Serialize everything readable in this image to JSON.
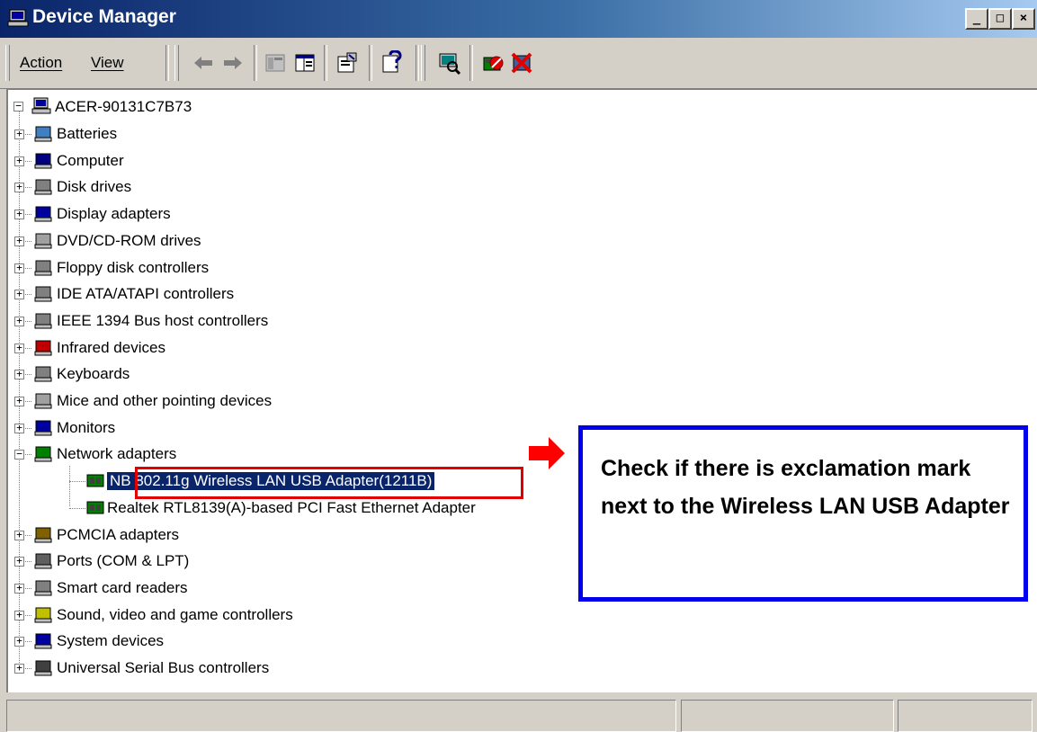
{
  "window": {
    "title": "Device Manager",
    "controls": {
      "minimize": "_",
      "maximize": "□",
      "close": "×"
    }
  },
  "menu": {
    "action_label": "Action",
    "view_label": "View"
  },
  "toolbar_icons": [
    "back-arrow-icon",
    "forward-arrow-icon",
    "show-hide-console-tree-icon",
    "detail-view-icon",
    "properties-icon",
    "help-icon",
    "scan-hardware-icon",
    "uninstall-icon",
    "disable-device-icon"
  ],
  "tree": {
    "root": "ACER-90131C7B73",
    "categories": [
      {
        "label": "Batteries",
        "icon": "battery-icon"
      },
      {
        "label": "Computer",
        "icon": "computer-icon"
      },
      {
        "label": "Disk drives",
        "icon": "disk-drive-icon"
      },
      {
        "label": "Display adapters",
        "icon": "display-adapter-icon"
      },
      {
        "label": "DVD/CD-ROM drives",
        "icon": "dvd-drive-icon"
      },
      {
        "label": "Floppy disk controllers",
        "icon": "floppy-controller-icon"
      },
      {
        "label": "IDE ATA/ATAPI controllers",
        "icon": "ide-controller-icon"
      },
      {
        "label": "IEEE 1394 Bus host controllers",
        "icon": "ieee1394-icon"
      },
      {
        "label": "Infrared devices",
        "icon": "infrared-icon"
      },
      {
        "label": "Keyboards",
        "icon": "keyboard-icon"
      },
      {
        "label": "Mice and other pointing devices",
        "icon": "mouse-icon"
      },
      {
        "label": "Monitors",
        "icon": "monitor-icon"
      },
      {
        "label": "Network adapters",
        "icon": "network-adapter-icon",
        "expanded": true
      },
      {
        "label": "PCMCIA adapters",
        "icon": "pcmcia-icon"
      },
      {
        "label": "Ports (COM & LPT)",
        "icon": "port-icon"
      },
      {
        "label": "Smart card readers",
        "icon": "smart-card-icon"
      },
      {
        "label": "Sound, video and game controllers",
        "icon": "sound-icon"
      },
      {
        "label": "System devices",
        "icon": "system-device-icon"
      },
      {
        "label": "Universal Serial Bus controllers",
        "icon": "usb-icon"
      }
    ],
    "network_children": [
      {
        "label": "NB 802.11g Wireless LAN USB Adapter(1211B)",
        "selected": true
      },
      {
        "label": "Realtek RTL8139(A)-based PCI Fast Ethernet Adapter",
        "selected": false
      }
    ]
  },
  "callout": {
    "text": "Check if there is exclamation mark next to the Wireless LAN USB Adapter"
  },
  "colors": {
    "selection": "#0a246a",
    "highlight_box": "#e00000",
    "callout_border": "#0000ee",
    "arrow": "#ff0000"
  }
}
